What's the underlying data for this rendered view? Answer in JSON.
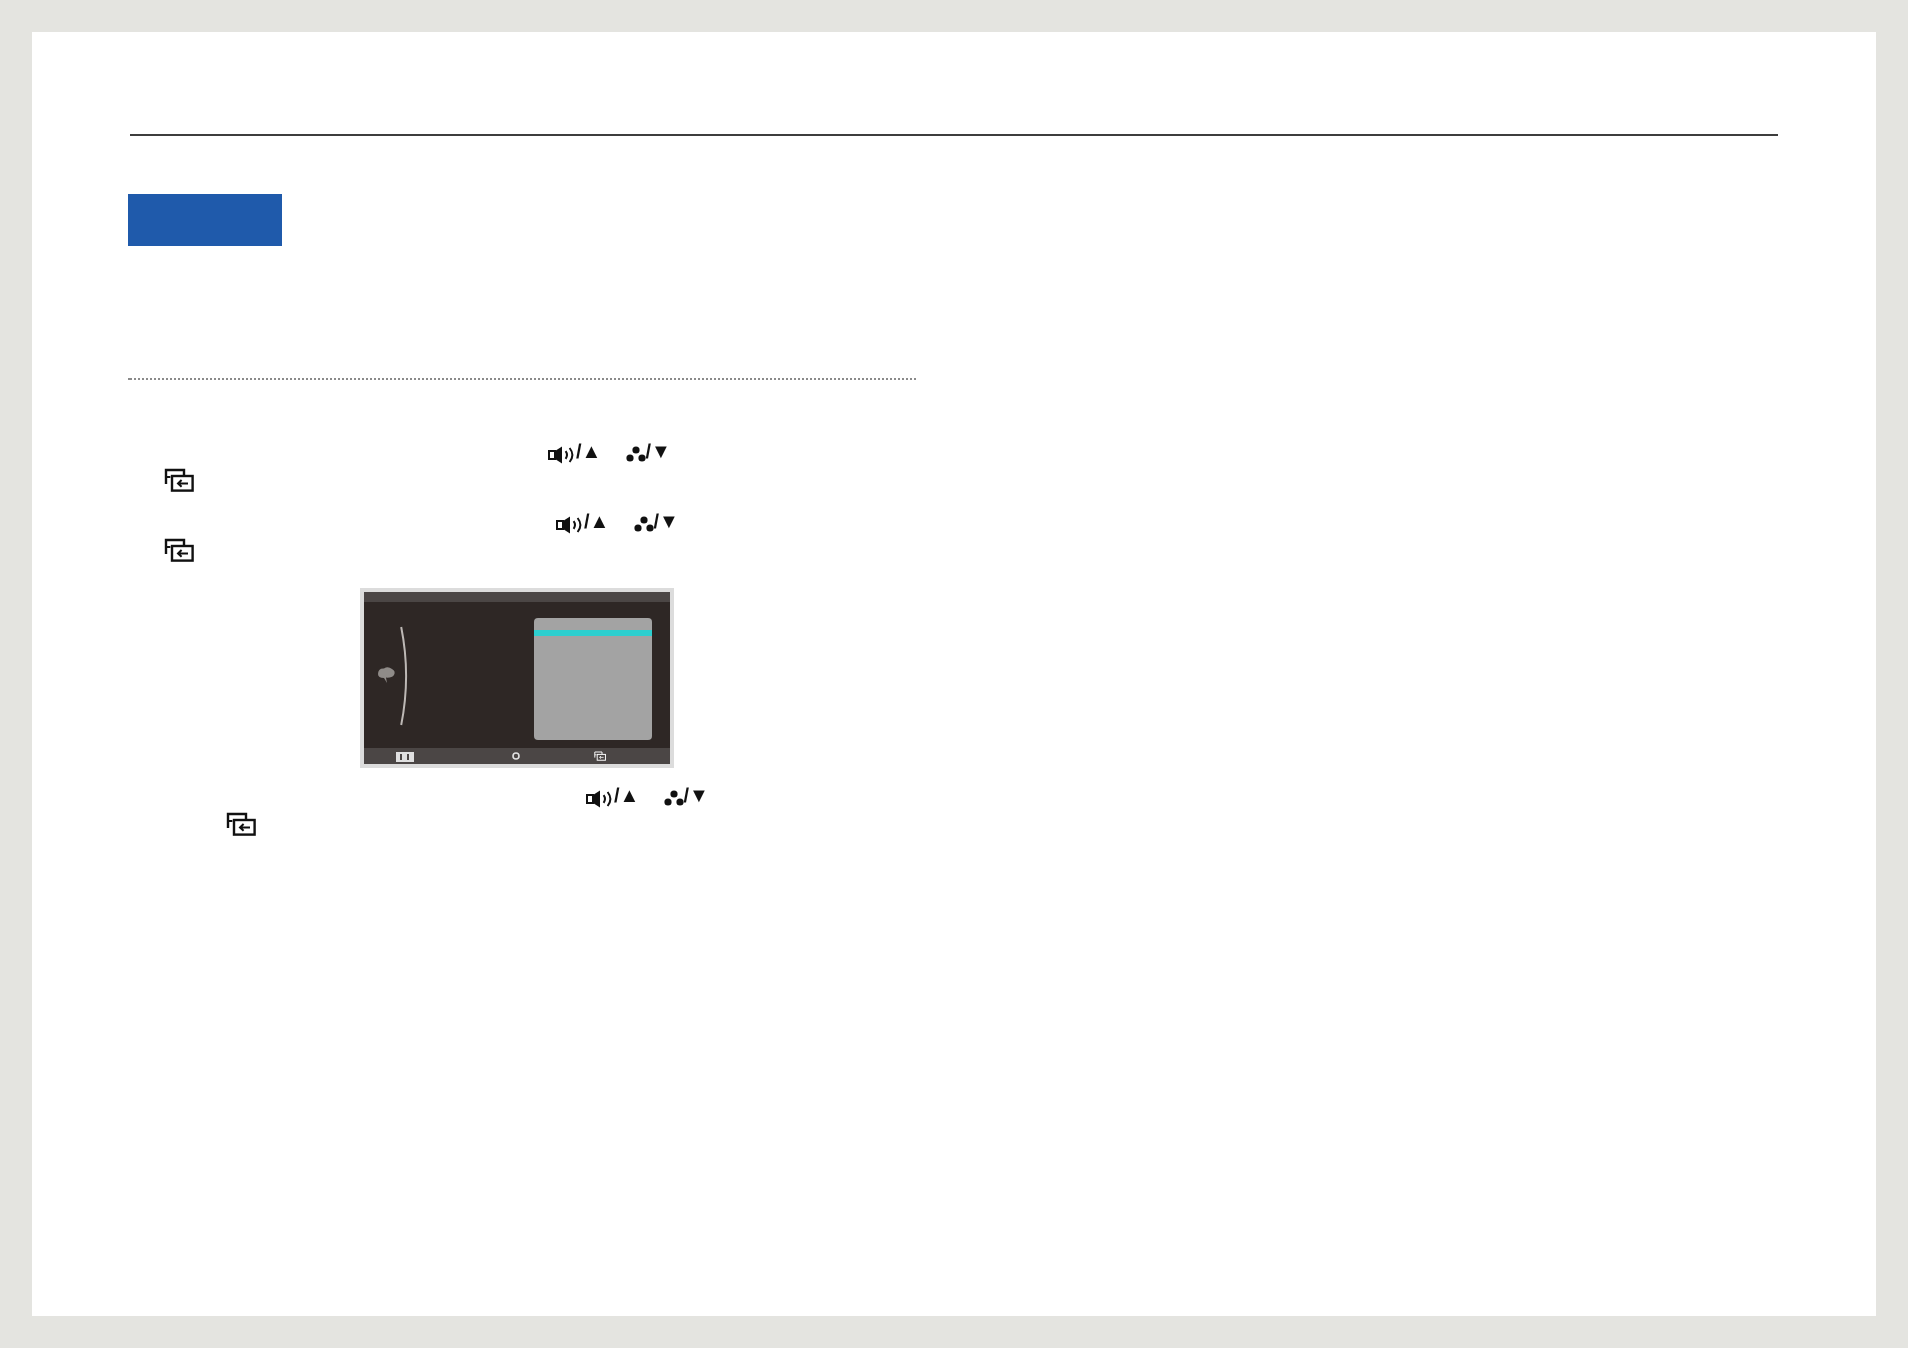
{
  "instructions": [
    {
      "keys": [
        "/▲",
        "/▼"
      ]
    },
    {
      "keys": [
        "/▲",
        "/▼"
      ]
    },
    {
      "keys": [
        "/▲",
        "/▼"
      ]
    }
  ]
}
